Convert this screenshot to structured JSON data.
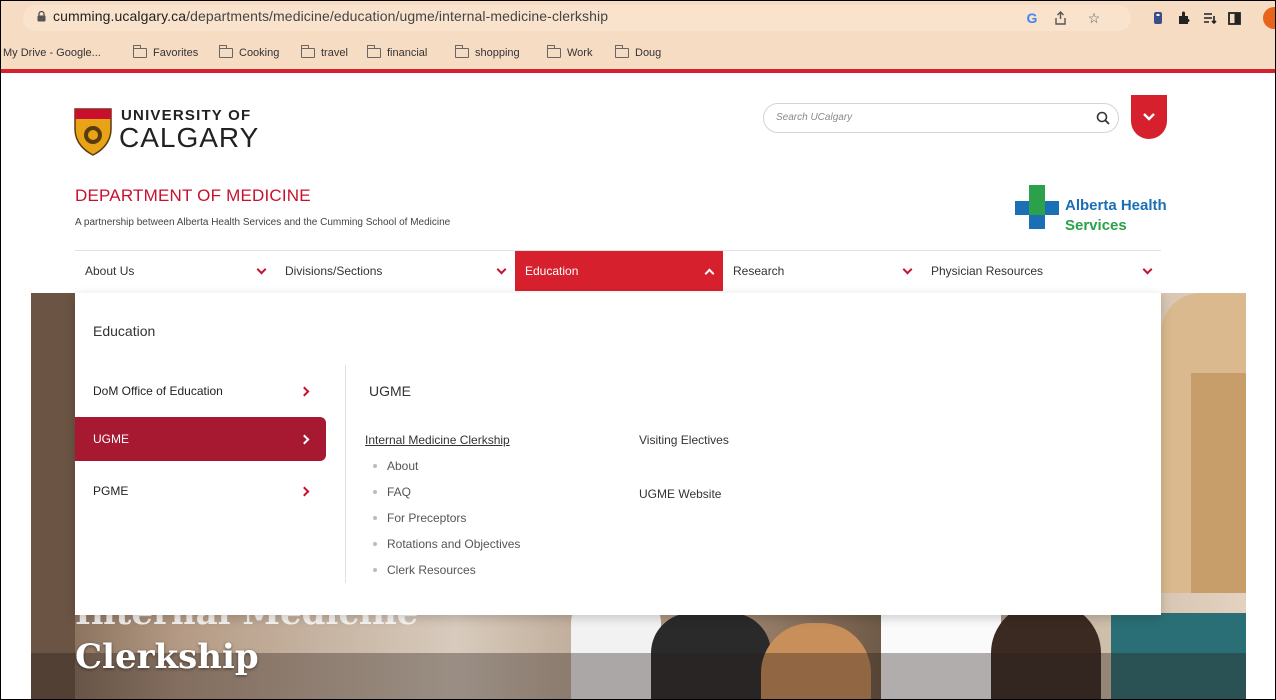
{
  "browser": {
    "url_host": "cumming.ucalgary.ca",
    "url_path": "/departments/medicine/education/ugme/internal-medicine-clerkship",
    "bookmarks": [
      "My Drive - Google...",
      "Favorites",
      "Cooking",
      "travel",
      "financial",
      "shopping",
      "Work",
      "Doug"
    ],
    "icons": [
      "google-icon",
      "share-icon",
      "star-icon",
      "extension-icon",
      "puzzle-icon",
      "reading-list-icon",
      "sidepanel-icon",
      "profile-icon"
    ]
  },
  "header": {
    "logo_line1": "UNIVERSITY OF",
    "logo_line2": "CALGARY",
    "search_placeholder": "Search UCalgary",
    "dept_title": "DEPARTMENT OF MEDICINE",
    "dept_subtitle": "A partnership between Alberta Health Services and the Cumming School of Medicine",
    "partner_line1": "Alberta Health",
    "partner_line2": "Services"
  },
  "nav": {
    "items": [
      "About Us",
      "Divisions/Sections",
      "Education",
      "Research",
      "Physician Resources"
    ],
    "active": "Education"
  },
  "dropdown": {
    "heading": "Education",
    "left_items": [
      "DoM Office of Education",
      "UGME",
      "PGME"
    ],
    "selected": "UGME",
    "section_title": "UGME",
    "main_link": "Internal Medicine Clerkship",
    "sub_links": [
      "About",
      "FAQ",
      "For Preceptors",
      "Rotations and Objectives",
      "Clerk Resources"
    ],
    "col2_links": [
      "Visiting Electives",
      "UGME Website"
    ]
  },
  "hero": {
    "title_top": "Internal Medicine",
    "title": "Clerkship"
  },
  "colors": {
    "brand_red": "#d6202d",
    "selected_red": "#a71930",
    "ahs_blue": "#1a6fb5",
    "ahs_green": "#2aa14a",
    "chrome_bg": "#f7dcc4"
  }
}
